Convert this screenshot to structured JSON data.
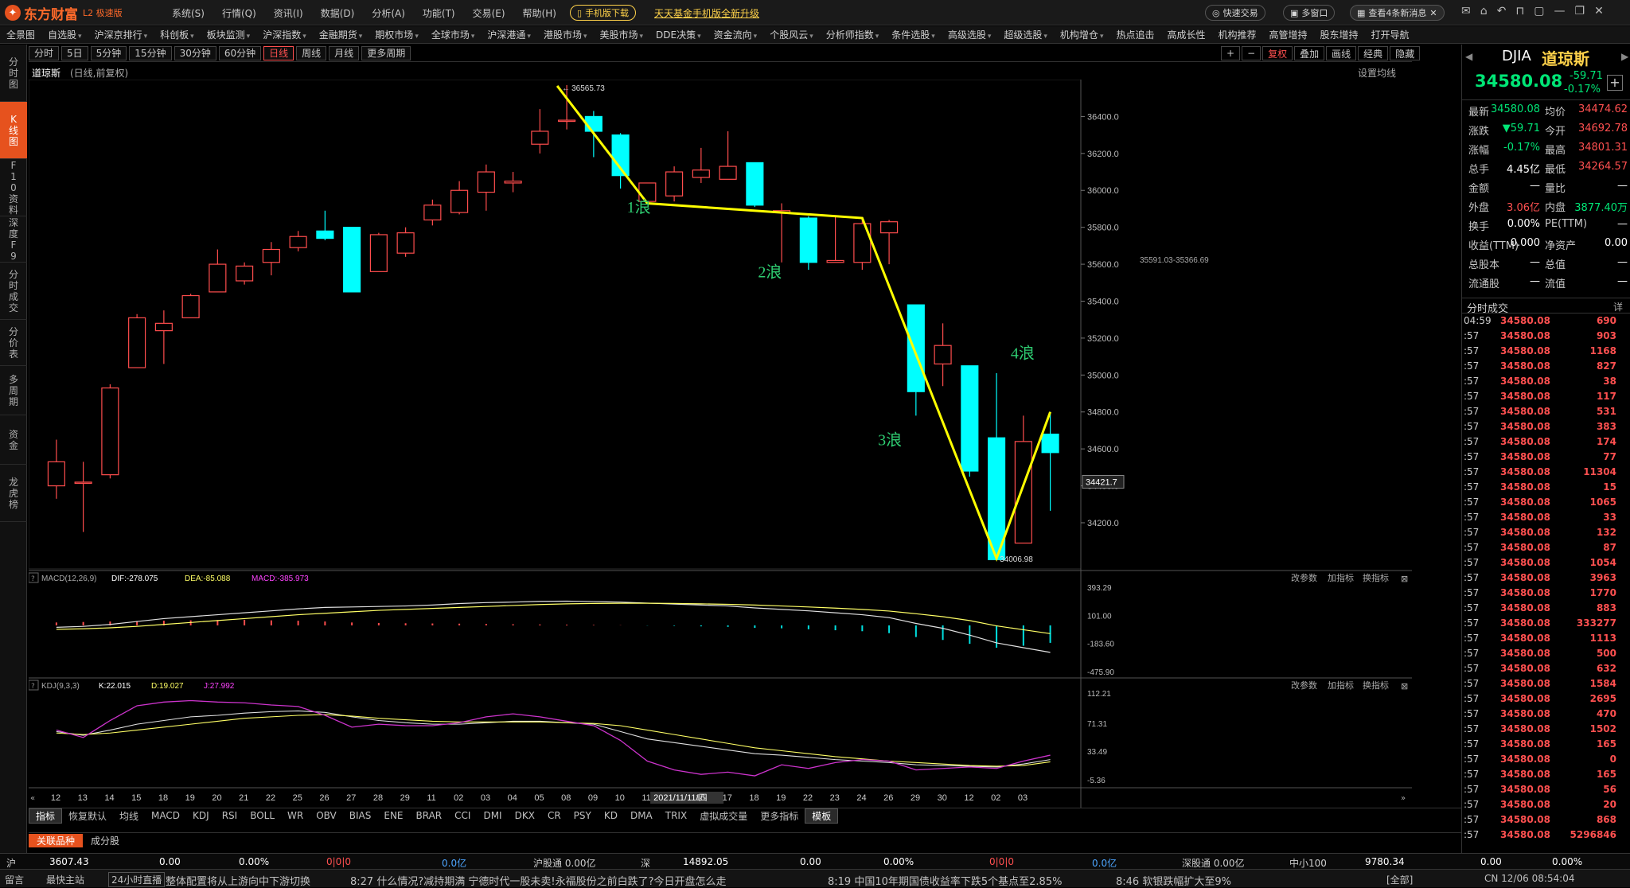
{
  "app": {
    "brand": "东方财富",
    "edition": "L2 极速版"
  },
  "topmenu": [
    "系统(S)",
    "行情(Q)",
    "资讯(I)",
    "数据(D)",
    "分析(A)",
    "功能(T)",
    "交易(E)",
    "帮助(H)"
  ],
  "promo": {
    "mobile": "手机版下载",
    "fund": "天天基金手机版全新升级",
    "quick_trade": "快速交易",
    "multi_window": "多窗口",
    "news": "查看4条新消息"
  },
  "navbar": [
    "全景图",
    "自选股",
    "沪深京排行",
    "科创板",
    "板块监测",
    "沪深指数",
    "金融期货",
    "期权市场",
    "全球市场",
    "沪深港通",
    "港股市场",
    "美股市场",
    "DDE决策",
    "资金流向",
    "个股风云",
    "分析师指数",
    "条件选股",
    "高级选股",
    "超级选股",
    "机构增仓",
    "热点追击",
    "高成长性",
    "机构推荐",
    "高管增持",
    "股东增持",
    "打开导航"
  ],
  "leftsb": [
    "分时图",
    "K线图",
    "F10资料",
    "深度F9",
    "分时成交",
    "分价表",
    "多周期",
    "资金",
    "龙虎榜"
  ],
  "periods": [
    "分时",
    "5日",
    "5分钟",
    "15分钟",
    "30分钟",
    "60分钟",
    "日线",
    "周线",
    "月线",
    "更多周期"
  ],
  "period_active": "日线",
  "tools": [
    "+",
    "−",
    "复权",
    "叠加",
    "画线",
    "经典",
    "隐藏"
  ],
  "chart_title": {
    "name": "道琼斯",
    "sub": "(日线,前复权)",
    "settings": "设置均线"
  },
  "price_axis": [
    "36400.0",
    "36200.0",
    "36000.0",
    "35800.0",
    "35600.0",
    "35400.0",
    "35200.0",
    "35000.0",
    "34800.0",
    "34600.0",
    "34400.0",
    "34200.0"
  ],
  "current_price_label": "34421.7",
  "annotations": {
    "high": "36565.73",
    "low": "34006.98",
    "zone": "35591.03-35366.69",
    "w1": "1浪",
    "w2": "2浪",
    "w3": "3浪",
    "w4": "4浪"
  },
  "dates": [
    "12",
    "13",
    "14",
    "15",
    "18",
    "19",
    "20",
    "21",
    "22",
    "25",
    "26",
    "27",
    "28",
    "29",
    "11",
    "02",
    "03",
    "04",
    "05",
    "08",
    "09",
    "10",
    "11",
    "2021/11/11/四",
    "16",
    "17",
    "18",
    "19",
    "22",
    "23",
    "24",
    "26",
    "29",
    "30",
    "12",
    "02",
    "03"
  ],
  "macd": {
    "label": "MACD(12,26,9)",
    "dif": "DIF:-278.075",
    "dea": "DEA:-85.088",
    "macd": "MACD:-385.973",
    "axis": [
      "393.29",
      "101.00",
      "-183.60",
      "-475.90"
    ]
  },
  "kdj": {
    "label": "KDJ(9,3,3)",
    "k": "K:22.015",
    "d": "D:19.027",
    "j": "J:27.992",
    "axis": [
      "112.21",
      "71.31",
      "33.49",
      "-5.36"
    ]
  },
  "ind_tools": [
    "改参数",
    "加指标",
    "换指标"
  ],
  "indicator_tabs": [
    "指标",
    "恢复默认",
    "均线",
    "MACD",
    "KDJ",
    "RSI",
    "BOLL",
    "WR",
    "OBV",
    "BIAS",
    "ENE",
    "BRAR",
    "CCI",
    "DMI",
    "DKX",
    "CR",
    "PSY",
    "KD",
    "DMA",
    "TRIX",
    "虚拟成交量",
    "更多指标",
    "模板"
  ],
  "rel_tabs": [
    "关联品种",
    "成分股"
  ],
  "right": {
    "code": "DJIA",
    "name": "道琼斯",
    "price": "34580.08",
    "change": "-59.71",
    "change_pct": "-0.17%",
    "rows": [
      [
        "最新",
        "34580.08",
        "均价",
        "34474.62"
      ],
      [
        "涨跌",
        "▼59.71",
        "今开",
        "34692.78"
      ],
      [
        "涨幅",
        "-0.17%",
        "最高",
        "34801.31"
      ],
      [
        "总手",
        "4.45亿",
        "最低",
        "34264.57"
      ],
      [
        "金额",
        "—",
        "量比",
        "—"
      ],
      [
        "外盘",
        "3.06亿",
        "内盘",
        "3877.40万"
      ],
      [
        "换手",
        "0.00%",
        "PE(TTM)",
        "—"
      ],
      [
        "收益(TTM)",
        "0.000",
        "净资产",
        "0.00"
      ],
      [
        "总股本",
        "—",
        "总值",
        "—"
      ],
      [
        "流通股",
        "—",
        "流值",
        "—"
      ]
    ],
    "trades_title": "分时成交",
    "trades_more": "详",
    "trades": [
      [
        "04:59",
        "34580.08",
        "690"
      ],
      [
        ":57",
        "34580.08",
        "903"
      ],
      [
        ":57",
        "34580.08",
        "1168"
      ],
      [
        ":57",
        "34580.08",
        "827"
      ],
      [
        ":57",
        "34580.08",
        "38"
      ],
      [
        ":57",
        "34580.08",
        "117"
      ],
      [
        ":57",
        "34580.08",
        "531"
      ],
      [
        ":57",
        "34580.08",
        "383"
      ],
      [
        ":57",
        "34580.08",
        "174"
      ],
      [
        ":57",
        "34580.08",
        "77"
      ],
      [
        ":57",
        "34580.08",
        "11304"
      ],
      [
        ":57",
        "34580.08",
        "15"
      ],
      [
        ":57",
        "34580.08",
        "1065"
      ],
      [
        ":57",
        "34580.08",
        "33"
      ],
      [
        ":57",
        "34580.08",
        "132"
      ],
      [
        ":57",
        "34580.08",
        "87"
      ],
      [
        ":57",
        "34580.08",
        "1054"
      ],
      [
        ":57",
        "34580.08",
        "3963"
      ],
      [
        ":57",
        "34580.08",
        "1770"
      ],
      [
        ":57",
        "34580.08",
        "883"
      ],
      [
        ":57",
        "34580.08",
        "333277"
      ],
      [
        ":57",
        "34580.08",
        "1113"
      ],
      [
        ":57",
        "34580.08",
        "500"
      ],
      [
        ":57",
        "34580.08",
        "632"
      ],
      [
        ":57",
        "34580.08",
        "1584"
      ],
      [
        ":57",
        "34580.08",
        "2695"
      ],
      [
        ":57",
        "34580.08",
        "470"
      ],
      [
        ":57",
        "34580.08",
        "1502"
      ],
      [
        ":57",
        "34580.08",
        "165"
      ],
      [
        ":57",
        "34580.08",
        "0"
      ],
      [
        ":57",
        "34580.08",
        "165"
      ],
      [
        ":57",
        "34580.08",
        "56"
      ],
      [
        ":57",
        "34580.08",
        "20"
      ],
      [
        ":57",
        "34580.08",
        "868"
      ],
      [
        ":57",
        "34580.08",
        "5296846"
      ]
    ]
  },
  "status": {
    "sh_label": "沪",
    "sh": "3607.43",
    "sh_chg": "0.00",
    "sh_pct": "0.00%",
    "sh_cnt": "0|0|0",
    "sh_amt": "0.0亿",
    "hgt": "沪股通 0.00亿",
    "sz_label": "深",
    "sz": "14892.05",
    "sz_chg": "0.00",
    "sz_pct": "0.00%",
    "sz_cnt": "0|0|0",
    "sz_amt": "0.0亿",
    "sgt": "深股通 0.00亿",
    "zx_label": "中小100",
    "zx": "9780.34",
    "zx_chg": "0.00",
    "zx_pct": "0.00%"
  },
  "news": {
    "left": "留言",
    "station": "最快主站",
    "live": "24小时直播",
    "items": [
      "整体配置将从上游向中下游切换",
      "8:27 什么情况?减持期满 宁德时代一股未卖!永福股份之前白跌了?今日开盘怎么走",
      "8:19 中国10年期国债收益率下跌5个基点至2.85%",
      "8:46 软银跌幅扩大至9%"
    ],
    "all": "[全部]",
    "clock": "CN 12/06 08:54:04"
  },
  "chart_data": {
    "type": "candlestick",
    "title": "道琼斯 (日线,前复权)",
    "ylim": [
      33950,
      36600
    ],
    "candles": [
      {
        "o": 34400,
        "c": 34530,
        "h": 34650,
        "l": 34330
      },
      {
        "o": 34420,
        "c": 34420,
        "h": 34530,
        "l": 34150
      },
      {
        "o": 34460,
        "c": 34930,
        "h": 34950,
        "l": 34440
      },
      {
        "o": 35040,
        "c": 35310,
        "h": 35330,
        "l": 35040
      },
      {
        "o": 35240,
        "c": 35280,
        "h": 35350,
        "l": 35060
      },
      {
        "o": 35310,
        "c": 35430,
        "h": 35440,
        "l": 35310
      },
      {
        "o": 35450,
        "c": 35600,
        "h": 35680,
        "l": 35450
      },
      {
        "o": 35510,
        "c": 35590,
        "h": 35610,
        "l": 35490
      },
      {
        "o": 35610,
        "c": 35680,
        "h": 35720,
        "l": 35540
      },
      {
        "o": 35690,
        "c": 35750,
        "h": 35780,
        "l": 35670
      },
      {
        "o": 35780,
        "c": 35740,
        "h": 35890,
        "l": 35730
      },
      {
        "o": 35800,
        "c": 35450,
        "h": 35800,
        "l": 35450
      },
      {
        "o": 35560,
        "c": 35760,
        "h": 35770,
        "l": 35560
      },
      {
        "o": 35660,
        "c": 35770,
        "h": 35800,
        "l": 35640
      },
      {
        "o": 35840,
        "c": 35920,
        "h": 35950,
        "l": 35810
      },
      {
        "o": 35880,
        "c": 36000,
        "h": 36050,
        "l": 35870
      },
      {
        "o": 35990,
        "c": 36100,
        "h": 36140,
        "l": 35890
      },
      {
        "o": 36040,
        "c": 36050,
        "h": 36100,
        "l": 35990
      },
      {
        "o": 36250,
        "c": 36320,
        "h": 36440,
        "l": 36200
      },
      {
        "o": 36380,
        "c": 36380,
        "h": 36570,
        "l": 36330
      },
      {
        "o": 36400,
        "c": 36320,
        "h": 36430,
        "l": 36180
      },
      {
        "o": 36300,
        "c": 36080,
        "h": 36310,
        "l": 36010
      },
      {
        "o": 35940,
        "c": 36040,
        "h": 36040,
        "l": 35930
      },
      {
        "o": 35970,
        "c": 36100,
        "h": 36130,
        "l": 35940
      },
      {
        "o": 36070,
        "c": 36110,
        "h": 36230,
        "l": 36040
      },
      {
        "o": 36060,
        "c": 36130,
        "h": 36320,
        "l": 36070
      },
      {
        "o": 36150,
        "c": 35920,
        "h": 36150,
        "l": 35910
      },
      {
        "o": 35880,
        "c": 35890,
        "h": 35930,
        "l": 35610
      },
      {
        "o": 35850,
        "c": 35610,
        "h": 35860,
        "l": 35570
      },
      {
        "o": 35610,
        "c": 35620,
        "h": 35860,
        "l": 35610
      },
      {
        "o": 35610,
        "c": 35820,
        "h": 35850,
        "l": 35570
      },
      {
        "o": 35770,
        "c": 35830,
        "h": 35840,
        "l": 35600
      },
      {
        "o": 35380,
        "c": 34910,
        "h": 35380,
        "l": 34780
      },
      {
        "o": 35060,
        "c": 35160,
        "h": 35280,
        "l": 34940
      },
      {
        "o": 35050,
        "c": 34480,
        "h": 35050,
        "l": 34450
      },
      {
        "o": 34660,
        "c": 34000,
        "h": 35010,
        "l": 34000
      },
      {
        "o": 34090,
        "c": 34640,
        "h": 34780,
        "l": 34090
      },
      {
        "o": 34680,
        "c": 34580,
        "h": 34801,
        "l": 34265
      }
    ],
    "wave_points": [
      [
        19,
        36565.73
      ],
      [
        22,
        35930
      ],
      [
        30,
        35850
      ],
      [
        35,
        34006.98
      ],
      [
        37,
        34800
      ]
    ],
    "wave_labels": [
      "1浪",
      "2浪",
      "3浪",
      "4浪"
    ]
  }
}
